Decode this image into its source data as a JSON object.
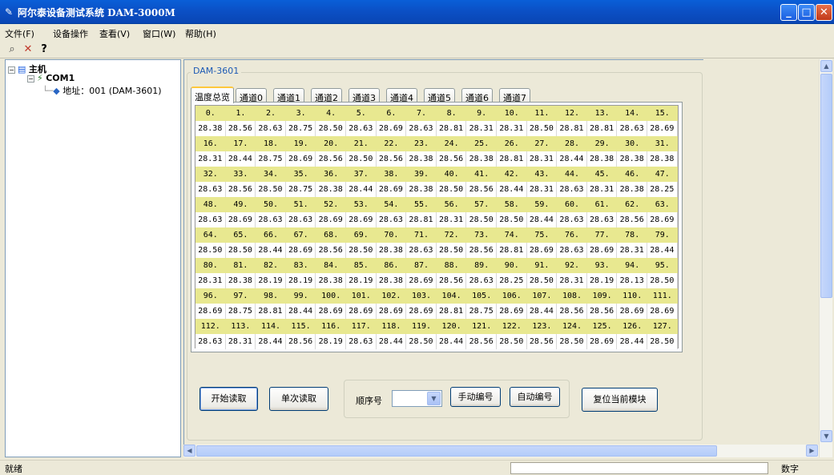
{
  "window": {
    "title": "阿尔泰设备测试系统 DAM-3000M",
    "buttons": [
      "minimize",
      "maximize",
      "close"
    ]
  },
  "menu": [
    "文件(F)",
    "设备操作",
    "查看(V)",
    "窗口(W)",
    "帮助(H)"
  ],
  "toolbar": [
    {
      "name": "search-icon",
      "glyph": "⌕"
    },
    {
      "name": "delete-icon",
      "glyph": "✕"
    },
    {
      "name": "help-icon",
      "glyph": "?"
    }
  ],
  "tree": {
    "root": "主机",
    "port": "COM1",
    "device": "地址：001 (DAM-3601)"
  },
  "group_label": "DAM-3601",
  "tabs": [
    "温度总览",
    "通道0",
    "通道1",
    "通道2",
    "通道3",
    "通道4",
    "通道5",
    "通道6",
    "通道7"
  ],
  "active_tab": "温度总览",
  "grid_rows": [
    {
      "labels": [
        "0.",
        "1.",
        "2.",
        "3.",
        "4.",
        "5.",
        "6.",
        "7.",
        "8.",
        "9.",
        "10.",
        "11.",
        "12.",
        "13.",
        "14.",
        "15."
      ],
      "values": [
        "28.38",
        "28.56",
        "28.63",
        "28.75",
        "28.50",
        "28.63",
        "28.69",
        "28.63",
        "28.81",
        "28.31",
        "28.31",
        "28.50",
        "28.81",
        "28.81",
        "28.63",
        "28.69"
      ]
    },
    {
      "labels": [
        "16.",
        "17.",
        "18.",
        "19.",
        "20.",
        "21.",
        "22.",
        "23.",
        "24.",
        "25.",
        "26.",
        "27.",
        "28.",
        "29.",
        "30.",
        "31."
      ],
      "values": [
        "28.31",
        "28.44",
        "28.75",
        "28.69",
        "28.56",
        "28.50",
        "28.56",
        "28.38",
        "28.56",
        "28.38",
        "28.81",
        "28.31",
        "28.44",
        "28.38",
        "28.38",
        "28.38"
      ]
    },
    {
      "labels": [
        "32.",
        "33.",
        "34.",
        "35.",
        "36.",
        "37.",
        "38.",
        "39.",
        "40.",
        "41.",
        "42.",
        "43.",
        "44.",
        "45.",
        "46.",
        "47."
      ],
      "values": [
        "28.63",
        "28.56",
        "28.50",
        "28.75",
        "28.38",
        "28.44",
        "28.69",
        "28.38",
        "28.50",
        "28.56",
        "28.44",
        "28.31",
        "28.63",
        "28.31",
        "28.38",
        "28.25"
      ]
    },
    {
      "labels": [
        "48.",
        "49.",
        "50.",
        "51.",
        "52.",
        "53.",
        "54.",
        "55.",
        "56.",
        "57.",
        "58.",
        "59.",
        "60.",
        "61.",
        "62.",
        "63."
      ],
      "values": [
        "28.63",
        "28.69",
        "28.63",
        "28.63",
        "28.69",
        "28.69",
        "28.63",
        "28.81",
        "28.31",
        "28.50",
        "28.50",
        "28.44",
        "28.63",
        "28.63",
        "28.56",
        "28.69"
      ]
    },
    {
      "labels": [
        "64.",
        "65.",
        "66.",
        "67.",
        "68.",
        "69.",
        "70.",
        "71.",
        "72.",
        "73.",
        "74.",
        "75.",
        "76.",
        "77.",
        "78.",
        "79."
      ],
      "values": [
        "28.50",
        "28.50",
        "28.44",
        "28.69",
        "28.56",
        "28.50",
        "28.38",
        "28.63",
        "28.50",
        "28.56",
        "28.81",
        "28.69",
        "28.63",
        "28.69",
        "28.31",
        "28.44"
      ]
    },
    {
      "labels": [
        "80.",
        "81.",
        "82.",
        "83.",
        "84.",
        "85.",
        "86.",
        "87.",
        "88.",
        "89.",
        "90.",
        "91.",
        "92.",
        "93.",
        "94.",
        "95."
      ],
      "values": [
        "28.31",
        "28.38",
        "28.19",
        "28.19",
        "28.38",
        "28.19",
        "28.38",
        "28.69",
        "28.56",
        "28.63",
        "28.25",
        "28.50",
        "28.31",
        "28.19",
        "28.13",
        "28.50"
      ]
    },
    {
      "labels": [
        "96.",
        "97.",
        "98.",
        "99.",
        "100.",
        "101.",
        "102.",
        "103.",
        "104.",
        "105.",
        "106.",
        "107.",
        "108.",
        "109.",
        "110.",
        "111."
      ],
      "values": [
        "28.69",
        "28.75",
        "28.81",
        "28.44",
        "28.69",
        "28.69",
        "28.69",
        "28.69",
        "28.81",
        "28.75",
        "28.69",
        "28.44",
        "28.56",
        "28.56",
        "28.69",
        "28.69"
      ]
    },
    {
      "labels": [
        "112.",
        "113.",
        "114.",
        "115.",
        "116.",
        "117.",
        "118.",
        "119.",
        "120.",
        "121.",
        "122.",
        "123.",
        "124.",
        "125.",
        "126.",
        "127."
      ],
      "values": [
        "28.63",
        "28.31",
        "28.44",
        "28.56",
        "28.19",
        "28.63",
        "28.44",
        "28.50",
        "28.44",
        "28.56",
        "28.50",
        "28.56",
        "28.50",
        "28.69",
        "28.44",
        "28.50"
      ]
    }
  ],
  "buttons": {
    "start_read": "开始读取",
    "single_read": "单次读取",
    "seq_label": "顺序号",
    "seq_value": "",
    "manual_number": "手动编号",
    "auto_number": "自动编号",
    "reset_module": "复位当前模块"
  },
  "status": {
    "text": "就绪",
    "mode": "数字"
  },
  "colors": {
    "titlebar": "#0b4fc4",
    "grid_header_row": "#e8e890",
    "group_label": "#1d5ab4",
    "active_tab_accent": "#ffc83c"
  }
}
